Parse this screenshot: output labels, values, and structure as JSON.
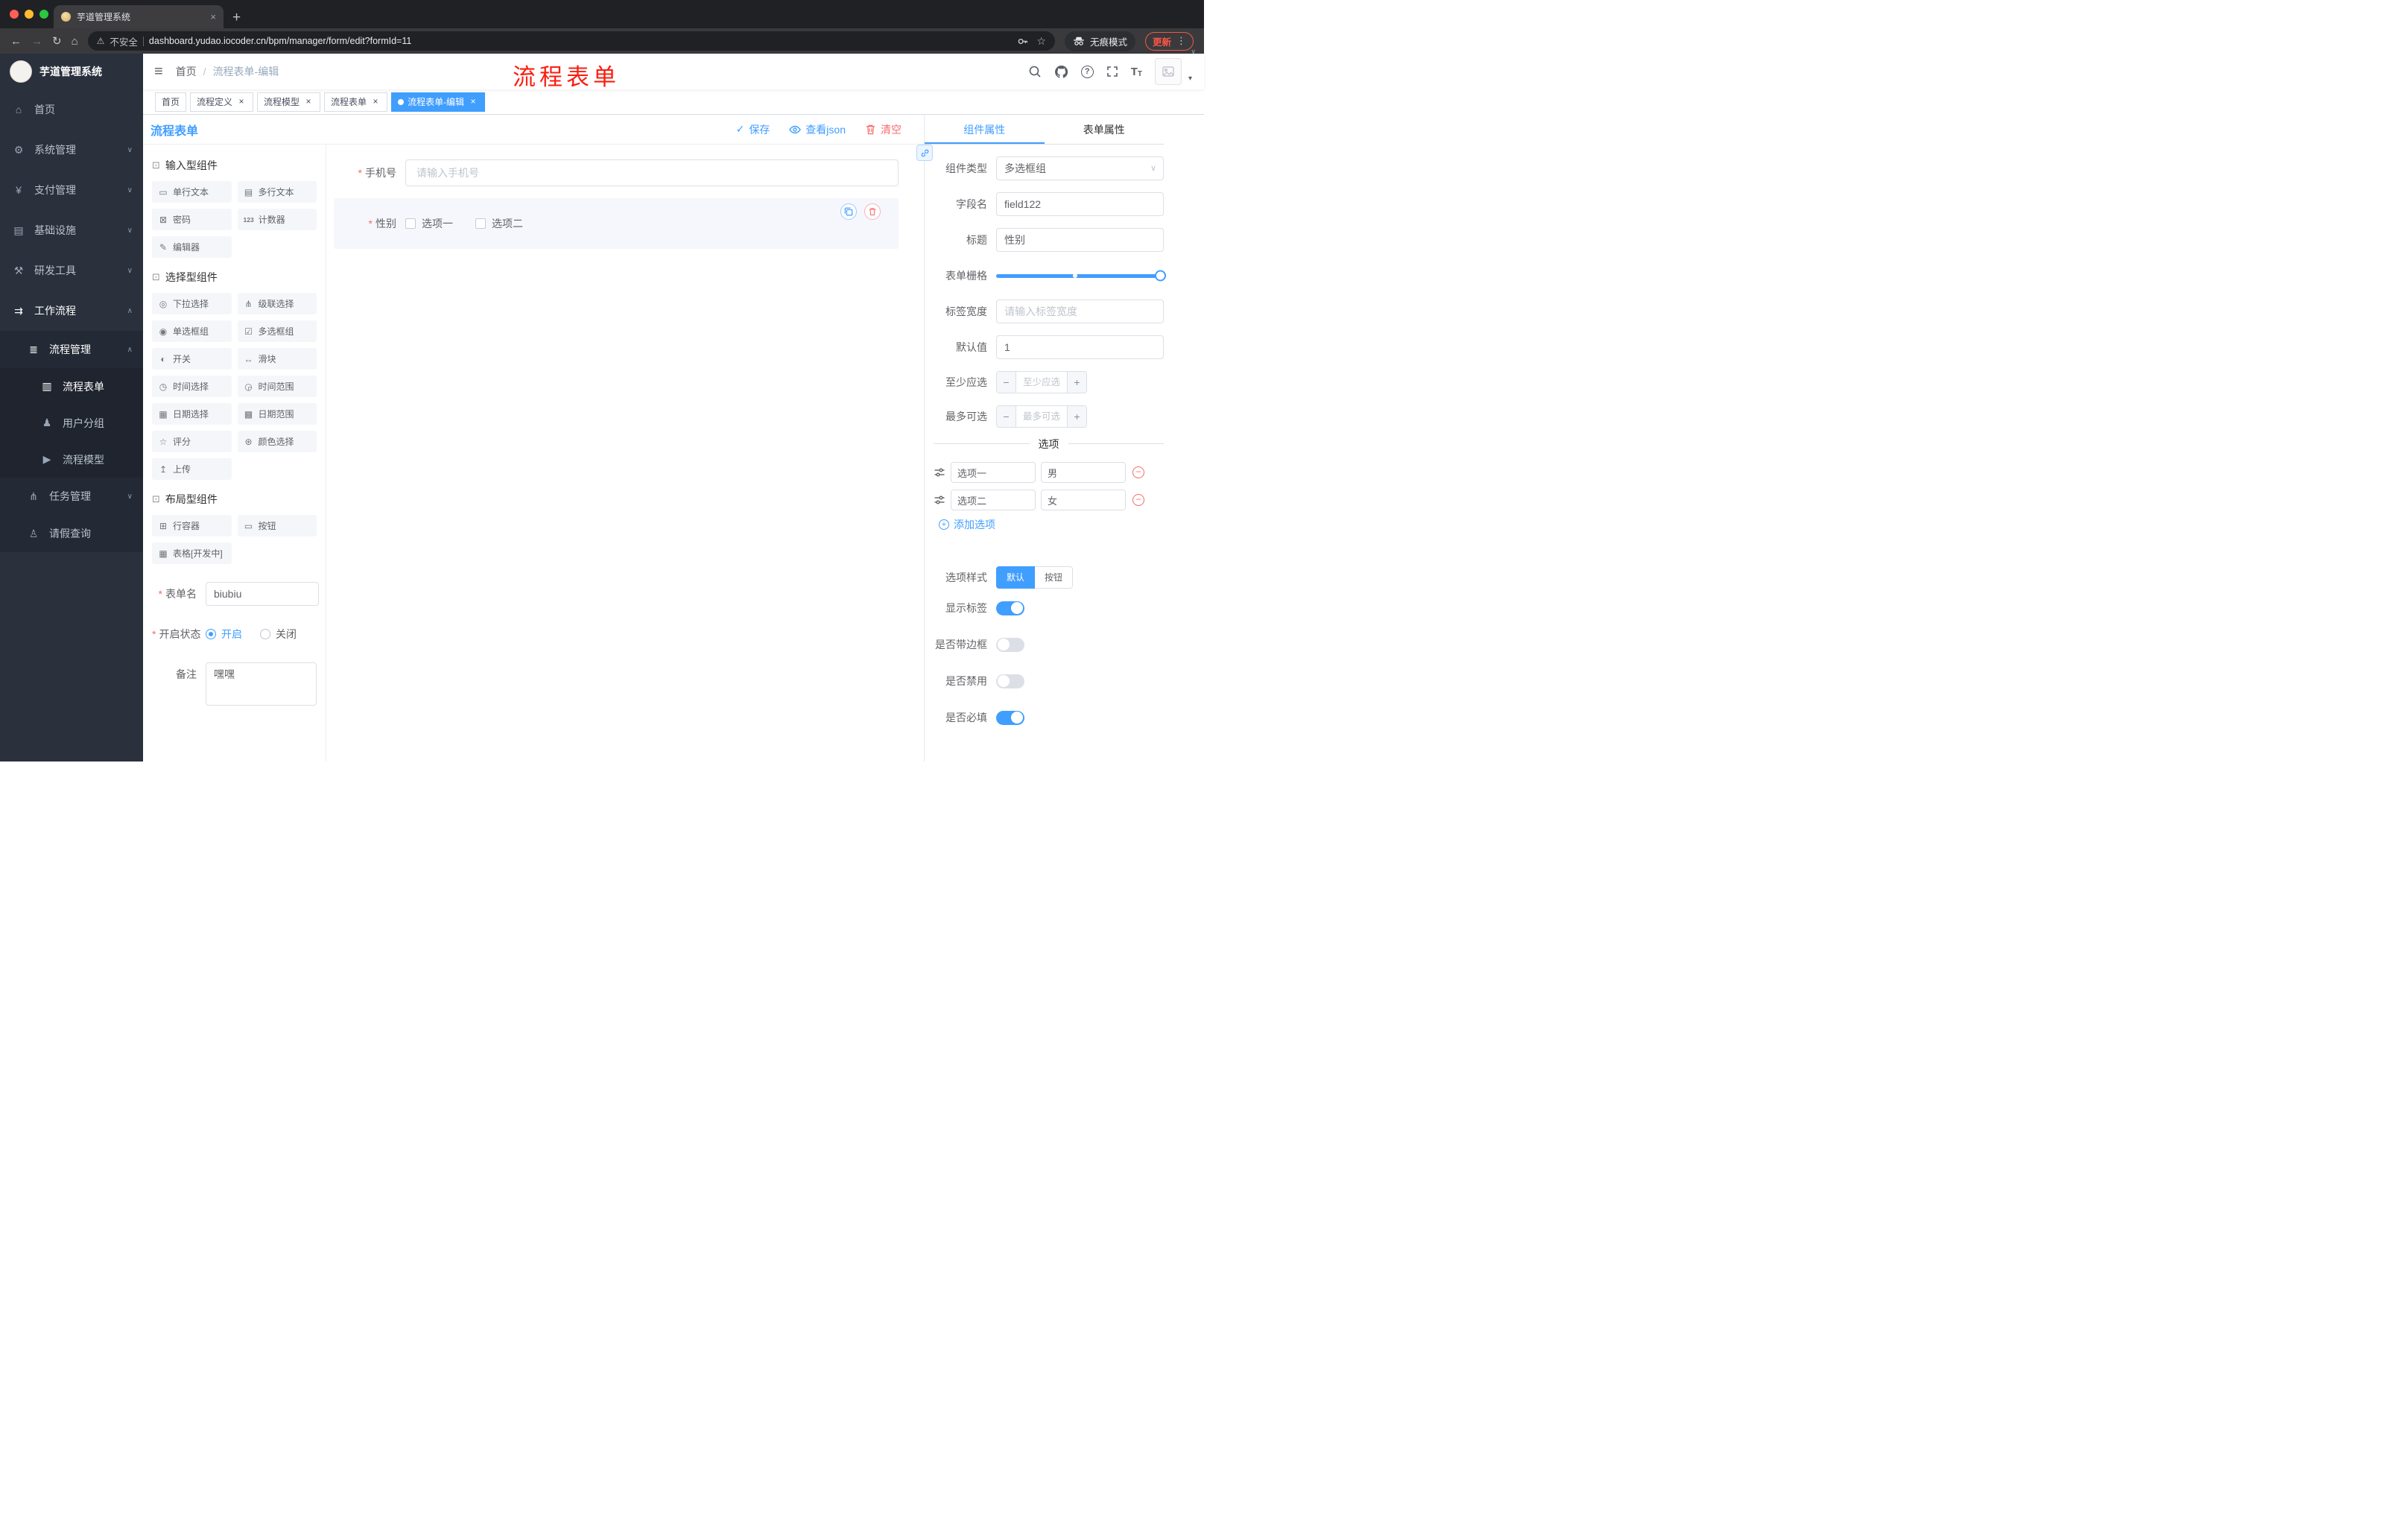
{
  "colors": {
    "primary": "#409eff",
    "danger": "#f56c6c",
    "annotation_red": "#fb1d10"
  },
  "glyphs": {
    "tab_close": "×",
    "new_tab": "+",
    "back": "←",
    "forward": "→",
    "reload": "↻",
    "home": "⌂",
    "warning": "⚠",
    "menu_dots": "⋮",
    "caret_down": "∨",
    "hamburger": "≡",
    "chevron_down": "∨",
    "chevron_up": "∧",
    "breadcrumb_sep": "/",
    "check": "✓",
    "question": "?",
    "text_size": "T",
    "select_arrow": "∨",
    "minus": "−",
    "plus": "+",
    "star": "☆",
    "dropdown_caret": "▾"
  },
  "browser": {
    "tab_title": "芋道管理系统",
    "security_label": "不安全",
    "url": "dashboard.yudao.iocoder.cn/bpm/manager/form/edit?formId=11",
    "incognito_label": "无痕模式",
    "update_label": "更新"
  },
  "sidebar": {
    "logo_title": "芋道管理系统",
    "home": "首页",
    "system": "系统管理",
    "payment": "支付管理",
    "infra": "基础设施",
    "devtool": "研发工具",
    "workflow": "工作流程",
    "process_mgmt": "流程管理",
    "process_form": "流程表单",
    "user_group": "用户分组",
    "process_model": "流程模型",
    "task_mgmt": "任务管理",
    "leave_query": "请假查询"
  },
  "sidebar_icons": {
    "home": "⌂",
    "system": "⚙",
    "payment": "¥",
    "infra": "▤",
    "devtool": "⚒",
    "workflow": "⇉",
    "process_mgmt": "≣",
    "process_form": "▥",
    "user_group": "♟",
    "process_model": "▶",
    "task_mgmt": "⋔",
    "leave_query": "♙"
  },
  "navbar": {
    "breadcrumb_home": "首页",
    "breadcrumb_current": "流程表单-编辑",
    "annotation": "流程表单"
  },
  "tags": {
    "t0": "首页",
    "t1": "流程定义",
    "t2": "流程模型",
    "t3": "流程表单",
    "t4": "流程表单-编辑"
  },
  "designer": {
    "title": "流程表单",
    "save": "保存",
    "view_json": "查看json",
    "clear": "清空"
  },
  "palette": {
    "group_icon": "⊡",
    "g1_title": "输入型组件",
    "g1": [
      "单行文本",
      "多行文本",
      "密码",
      "计数器",
      "编辑器"
    ],
    "g1_icons": [
      "▭",
      "▤",
      "⊠",
      "123",
      "✎"
    ],
    "g2_title": "选择型组件",
    "g2": [
      "下拉选择",
      "级联选择",
      "单选框组",
      "多选框组",
      "开关",
      "滑块",
      "时间选择",
      "时间范围",
      "日期选择",
      "日期范围",
      "评分",
      "颜色选择",
      "上传"
    ],
    "g2_icons": [
      "◎",
      "⋔",
      "◉",
      "☑",
      "◐",
      "↔",
      "◷",
      "◶",
      "▦",
      "▩",
      "☆",
      "⊛",
      "↥"
    ],
    "g3_title": "布局型组件",
    "g3": [
      "行容器",
      "按钮",
      "表格[开发中]"
    ],
    "g3_icons": [
      "⊞",
      "▭",
      "▦"
    ]
  },
  "meta": {
    "form_name_label": "表单名",
    "form_name_value": "biubiu",
    "status_label": "开启状态",
    "status_on": "开启",
    "status_off": "关闭",
    "remark_label": "备注",
    "remark_value": "嘿嘿"
  },
  "canvas": {
    "phone_label": "手机号",
    "phone_placeholder": "请输入手机号",
    "gender_label": "性别",
    "gender_opt1": "选项一",
    "gender_opt2": "选项二"
  },
  "panel": {
    "tab_component": "组件属性",
    "tab_form": "表单属性",
    "component_type_label": "组件类型",
    "component_type_value": "多选框组",
    "field_name_label": "字段名",
    "field_name_value": "field122",
    "title_label": "标题",
    "title_value": "性别",
    "grid_label": "表单栅格",
    "label_width_label": "标签宽度",
    "label_width_placeholder": "请输入标签宽度",
    "default_label": "默认值",
    "default_value": "1",
    "min_label": "至少应选",
    "min_placeholder": "至少应选",
    "max_label": "最多可选",
    "max_placeholder": "最多可选",
    "options_divider": "选项",
    "opt1_name": "选项一",
    "opt1_value": "男",
    "opt2_name": "选项二",
    "opt2_value": "女",
    "add_option": "添加选项",
    "style_label": "选项样式",
    "style_default": "默认",
    "style_button": "按钮",
    "switch_show_label": "显示标签",
    "switch_border": "是否带边框",
    "switch_disabled": "是否禁用",
    "switch_required": "是否必填"
  }
}
